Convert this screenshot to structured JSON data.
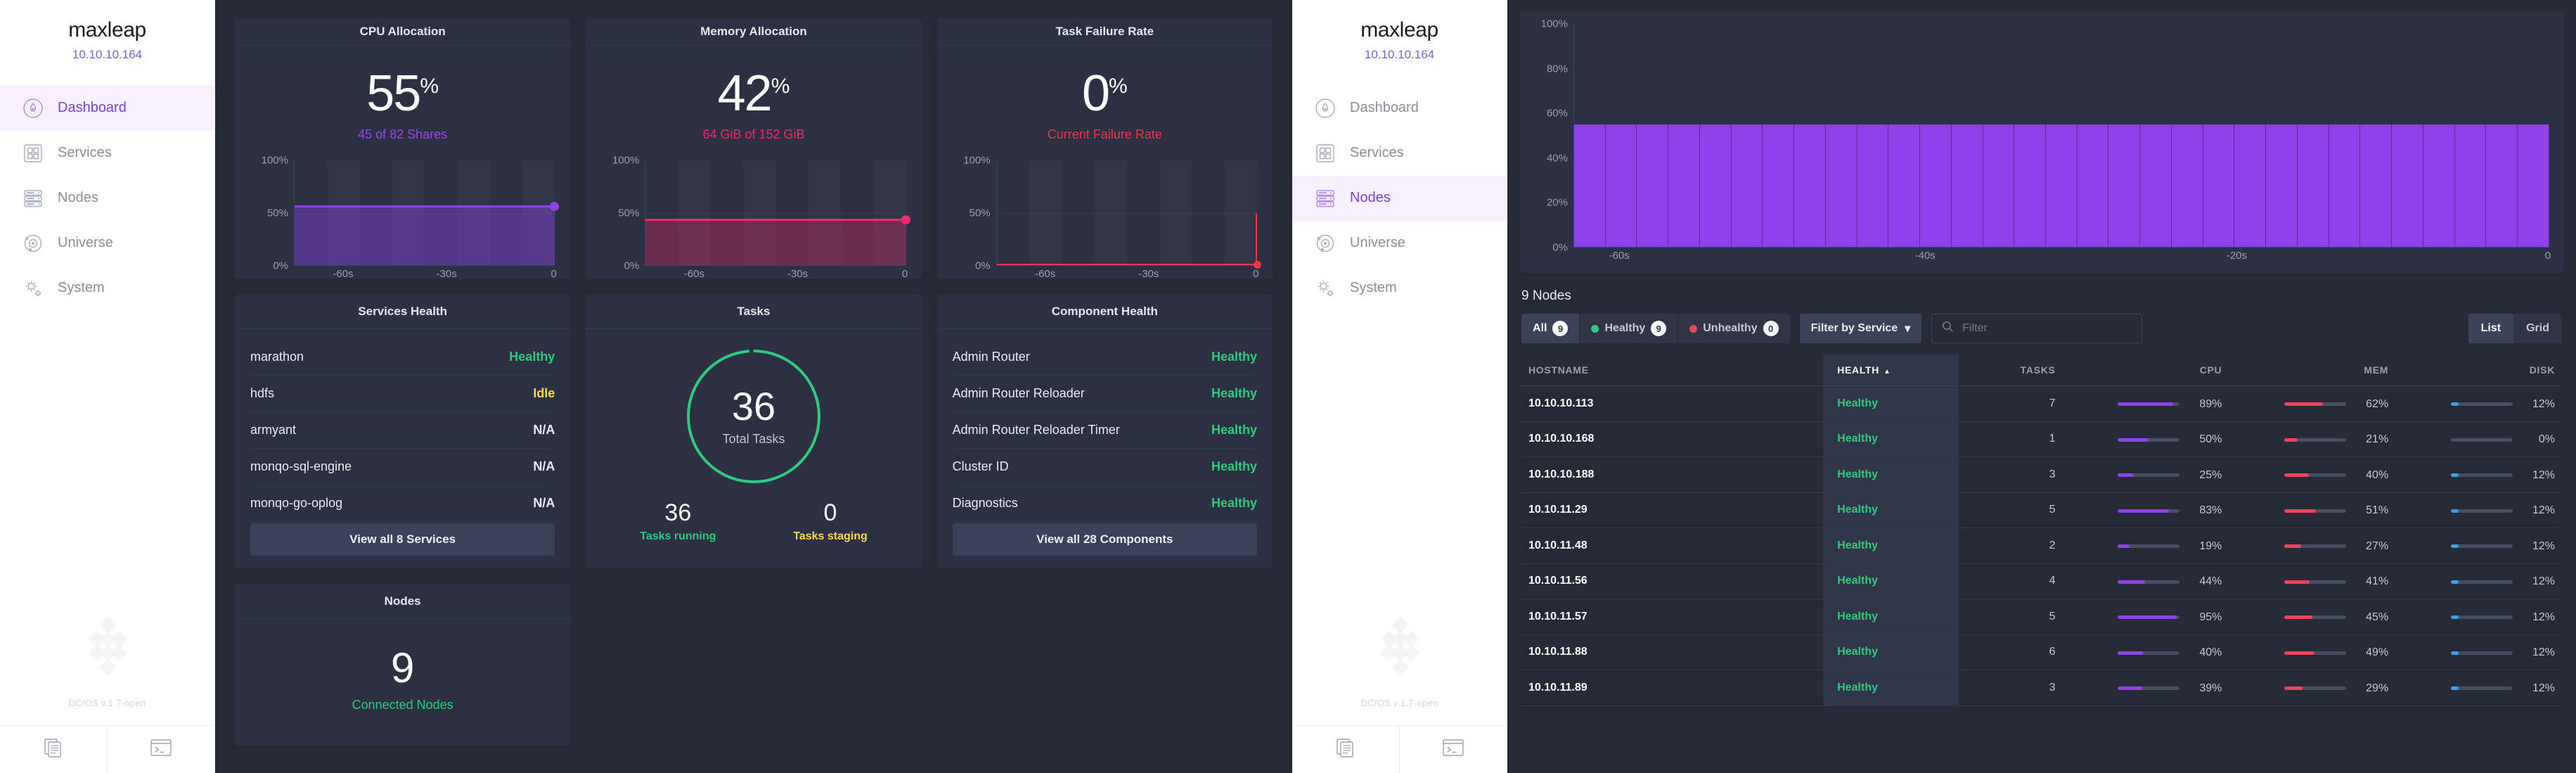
{
  "brand": {
    "name": "maxleap",
    "ip": "10.10.10.164",
    "version": "DC/OS v.1.7-open"
  },
  "sidebar": {
    "items": [
      {
        "label": "Dashboard",
        "icon": "gauge-icon"
      },
      {
        "label": "Services",
        "icon": "grid-icon"
      },
      {
        "label": "Nodes",
        "icon": "server-icon"
      },
      {
        "label": "Universe",
        "icon": "orbit-icon"
      },
      {
        "label": "System",
        "icon": "gear-icon"
      }
    ],
    "footer_buttons": [
      {
        "name": "docs-icon"
      },
      {
        "name": "cli-terminal-icon"
      }
    ]
  },
  "dashboard": {
    "cpu": {
      "title": "CPU Allocation",
      "value": "55",
      "unit": "%",
      "sub": "45 of 82 Shares",
      "color": "#9042ea"
    },
    "memory": {
      "title": "Memory Allocation",
      "value": "42",
      "unit": "%",
      "sub": "64 GiB of 152 GiB",
      "color": "#f1286a"
    },
    "failure": {
      "title": "Task Failure Rate",
      "value": "0",
      "unit": "%",
      "sub": "Current Failure Rate",
      "color": "#e8374c"
    },
    "axis": {
      "y": [
        "100%",
        "50%",
        "0%"
      ],
      "x": [
        "-60s",
        "-30s",
        "0"
      ]
    },
    "services_health": {
      "title": "Services Health",
      "rows": [
        {
          "name": "marathon",
          "status": "Healthy",
          "state": "healthy"
        },
        {
          "name": "hdfs",
          "status": "Idle",
          "state": "idle"
        },
        {
          "name": "armyant",
          "status": "N/A",
          "state": "na"
        },
        {
          "name": "monqo-sql-engine",
          "status": "N/A",
          "state": "na"
        },
        {
          "name": "monqo-go-oplog",
          "status": "N/A",
          "state": "na"
        }
      ],
      "button": "View all 8 Services"
    },
    "tasks": {
      "title": "Tasks",
      "total": "36",
      "total_label": "Total Tasks",
      "running": "36",
      "running_label": "Tasks running",
      "staging": "0",
      "staging_label": "Tasks staging"
    },
    "component_health": {
      "title": "Component Health",
      "rows": [
        {
          "name": "Admin Router",
          "status": "Healthy"
        },
        {
          "name": "Admin Router Reloader",
          "status": "Healthy"
        },
        {
          "name": "Admin Router Reloader Timer",
          "status": "Healthy"
        },
        {
          "name": "Cluster ID",
          "status": "Healthy"
        },
        {
          "name": "Diagnostics",
          "status": "Healthy"
        }
      ],
      "button": "View all 28 Components"
    },
    "nodes": {
      "title": "Nodes",
      "count": "9",
      "label": "Connected Nodes"
    }
  },
  "nodes_page": {
    "count_label": "9 Nodes",
    "filters": [
      {
        "label": "All",
        "count": "9",
        "dot": "none"
      },
      {
        "label": "Healthy",
        "count": "9",
        "dot": "green"
      },
      {
        "label": "Unhealthy",
        "count": "0",
        "dot": "red"
      }
    ],
    "filter_by_service": "Filter by Service",
    "search_placeholder": "Filter",
    "view_toggle": [
      "List",
      "Grid"
    ],
    "table": {
      "columns": [
        "HOSTNAME",
        "HEALTH",
        "TASKS",
        "CPU",
        "MEM",
        "DISK"
      ],
      "sorted_column": "HEALTH",
      "sort_dir": "asc",
      "rows": [
        {
          "hostname": "10.10.10.113",
          "health": "Healthy",
          "tasks": "7",
          "cpu": "89%",
          "mem": "62%",
          "disk": "12%"
        },
        {
          "hostname": "10.10.10.168",
          "health": "Healthy",
          "tasks": "1",
          "cpu": "50%",
          "mem": "21%",
          "disk": "0%"
        },
        {
          "hostname": "10.10.10.188",
          "health": "Healthy",
          "tasks": "3",
          "cpu": "25%",
          "mem": "40%",
          "disk": "12%"
        },
        {
          "hostname": "10.10.11.29",
          "health": "Healthy",
          "tasks": "5",
          "cpu": "83%",
          "mem": "51%",
          "disk": "12%"
        },
        {
          "hostname": "10.10.11.48",
          "health": "Healthy",
          "tasks": "2",
          "cpu": "19%",
          "mem": "27%",
          "disk": "12%"
        },
        {
          "hostname": "10.10.11.56",
          "health": "Healthy",
          "tasks": "4",
          "cpu": "44%",
          "mem": "41%",
          "disk": "12%"
        },
        {
          "hostname": "10.10.11.57",
          "health": "Healthy",
          "tasks": "5",
          "cpu": "95%",
          "mem": "45%",
          "disk": "12%"
        },
        {
          "hostname": "10.10.11.88",
          "health": "Healthy",
          "tasks": "6",
          "cpu": "40%",
          "mem": "49%",
          "disk": "12%"
        },
        {
          "hostname": "10.10.11.89",
          "health": "Healthy",
          "tasks": "3",
          "cpu": "39%",
          "mem": "29%",
          "disk": "12%"
        }
      ]
    }
  },
  "chart_data": [
    {
      "type": "area",
      "title": "CPU Allocation",
      "ylabel": "",
      "xlabel": "",
      "ylim": [
        0,
        100
      ],
      "yticks": [
        "0%",
        "50%",
        "100%"
      ],
      "xticks": [
        "-60s",
        "-30s",
        "0"
      ],
      "series": [
        {
          "name": "CPU Allocation",
          "value": 55,
          "color": "#9042ea"
        }
      ],
      "grid": true,
      "legend": "none"
    },
    {
      "type": "area",
      "title": "Memory Allocation",
      "ylim": [
        0,
        100
      ],
      "yticks": [
        "0%",
        "50%",
        "100%"
      ],
      "xticks": [
        "-60s",
        "-30s",
        "0"
      ],
      "series": [
        {
          "name": "Memory Allocation",
          "value": 42,
          "color": "#f1286a"
        }
      ],
      "grid": true,
      "legend": "none"
    },
    {
      "type": "area",
      "title": "Task Failure Rate",
      "ylim": [
        0,
        100
      ],
      "yticks": [
        "0%",
        "50%",
        "100%"
      ],
      "xticks": [
        "-60s",
        "-30s",
        "0"
      ],
      "series": [
        {
          "name": "Task Failure Rate",
          "value": 0,
          "color": "#e8374c"
        }
      ],
      "grid": true,
      "legend": "none"
    },
    {
      "type": "pie",
      "title": "Tasks",
      "labels": [
        "Tasks running",
        "Tasks staging"
      ],
      "values": [
        36,
        0
      ],
      "colors": [
        "#2fca7f",
        "#ffd84d"
      ],
      "total": 36,
      "center_label": "Total Tasks"
    },
    {
      "type": "bar",
      "title": "Nodes CPU Allocation",
      "ylim": [
        0,
        100
      ],
      "yticks": [
        "0%",
        "20%",
        "40%",
        "60%",
        "80%",
        "100%"
      ],
      "xticks": [
        "-60s",
        "-40s",
        "-20s",
        "0"
      ],
      "xlabel": "",
      "ylabel": "",
      "color": "#9042ea",
      "categories": [
        "-60",
        "-58",
        "-56",
        "-54",
        "-52",
        "-50",
        "-48",
        "-46",
        "-44",
        "-42",
        "-40",
        "-38",
        "-36",
        "-34",
        "-32",
        "-30",
        "-28",
        "-26",
        "-24",
        "-22",
        "-20",
        "-18",
        "-16",
        "-14",
        "-12",
        "-10",
        "-8",
        "-6",
        "-4",
        "-2",
        "0"
      ],
      "values": [
        55,
        55,
        55,
        55,
        55,
        55,
        55,
        55,
        55,
        55,
        55,
        55,
        55,
        55,
        55,
        55,
        55,
        55,
        55,
        55,
        55,
        55,
        55,
        55,
        55,
        55,
        55,
        55,
        55,
        55,
        55
      ],
      "grid": true,
      "legend": "none"
    }
  ]
}
